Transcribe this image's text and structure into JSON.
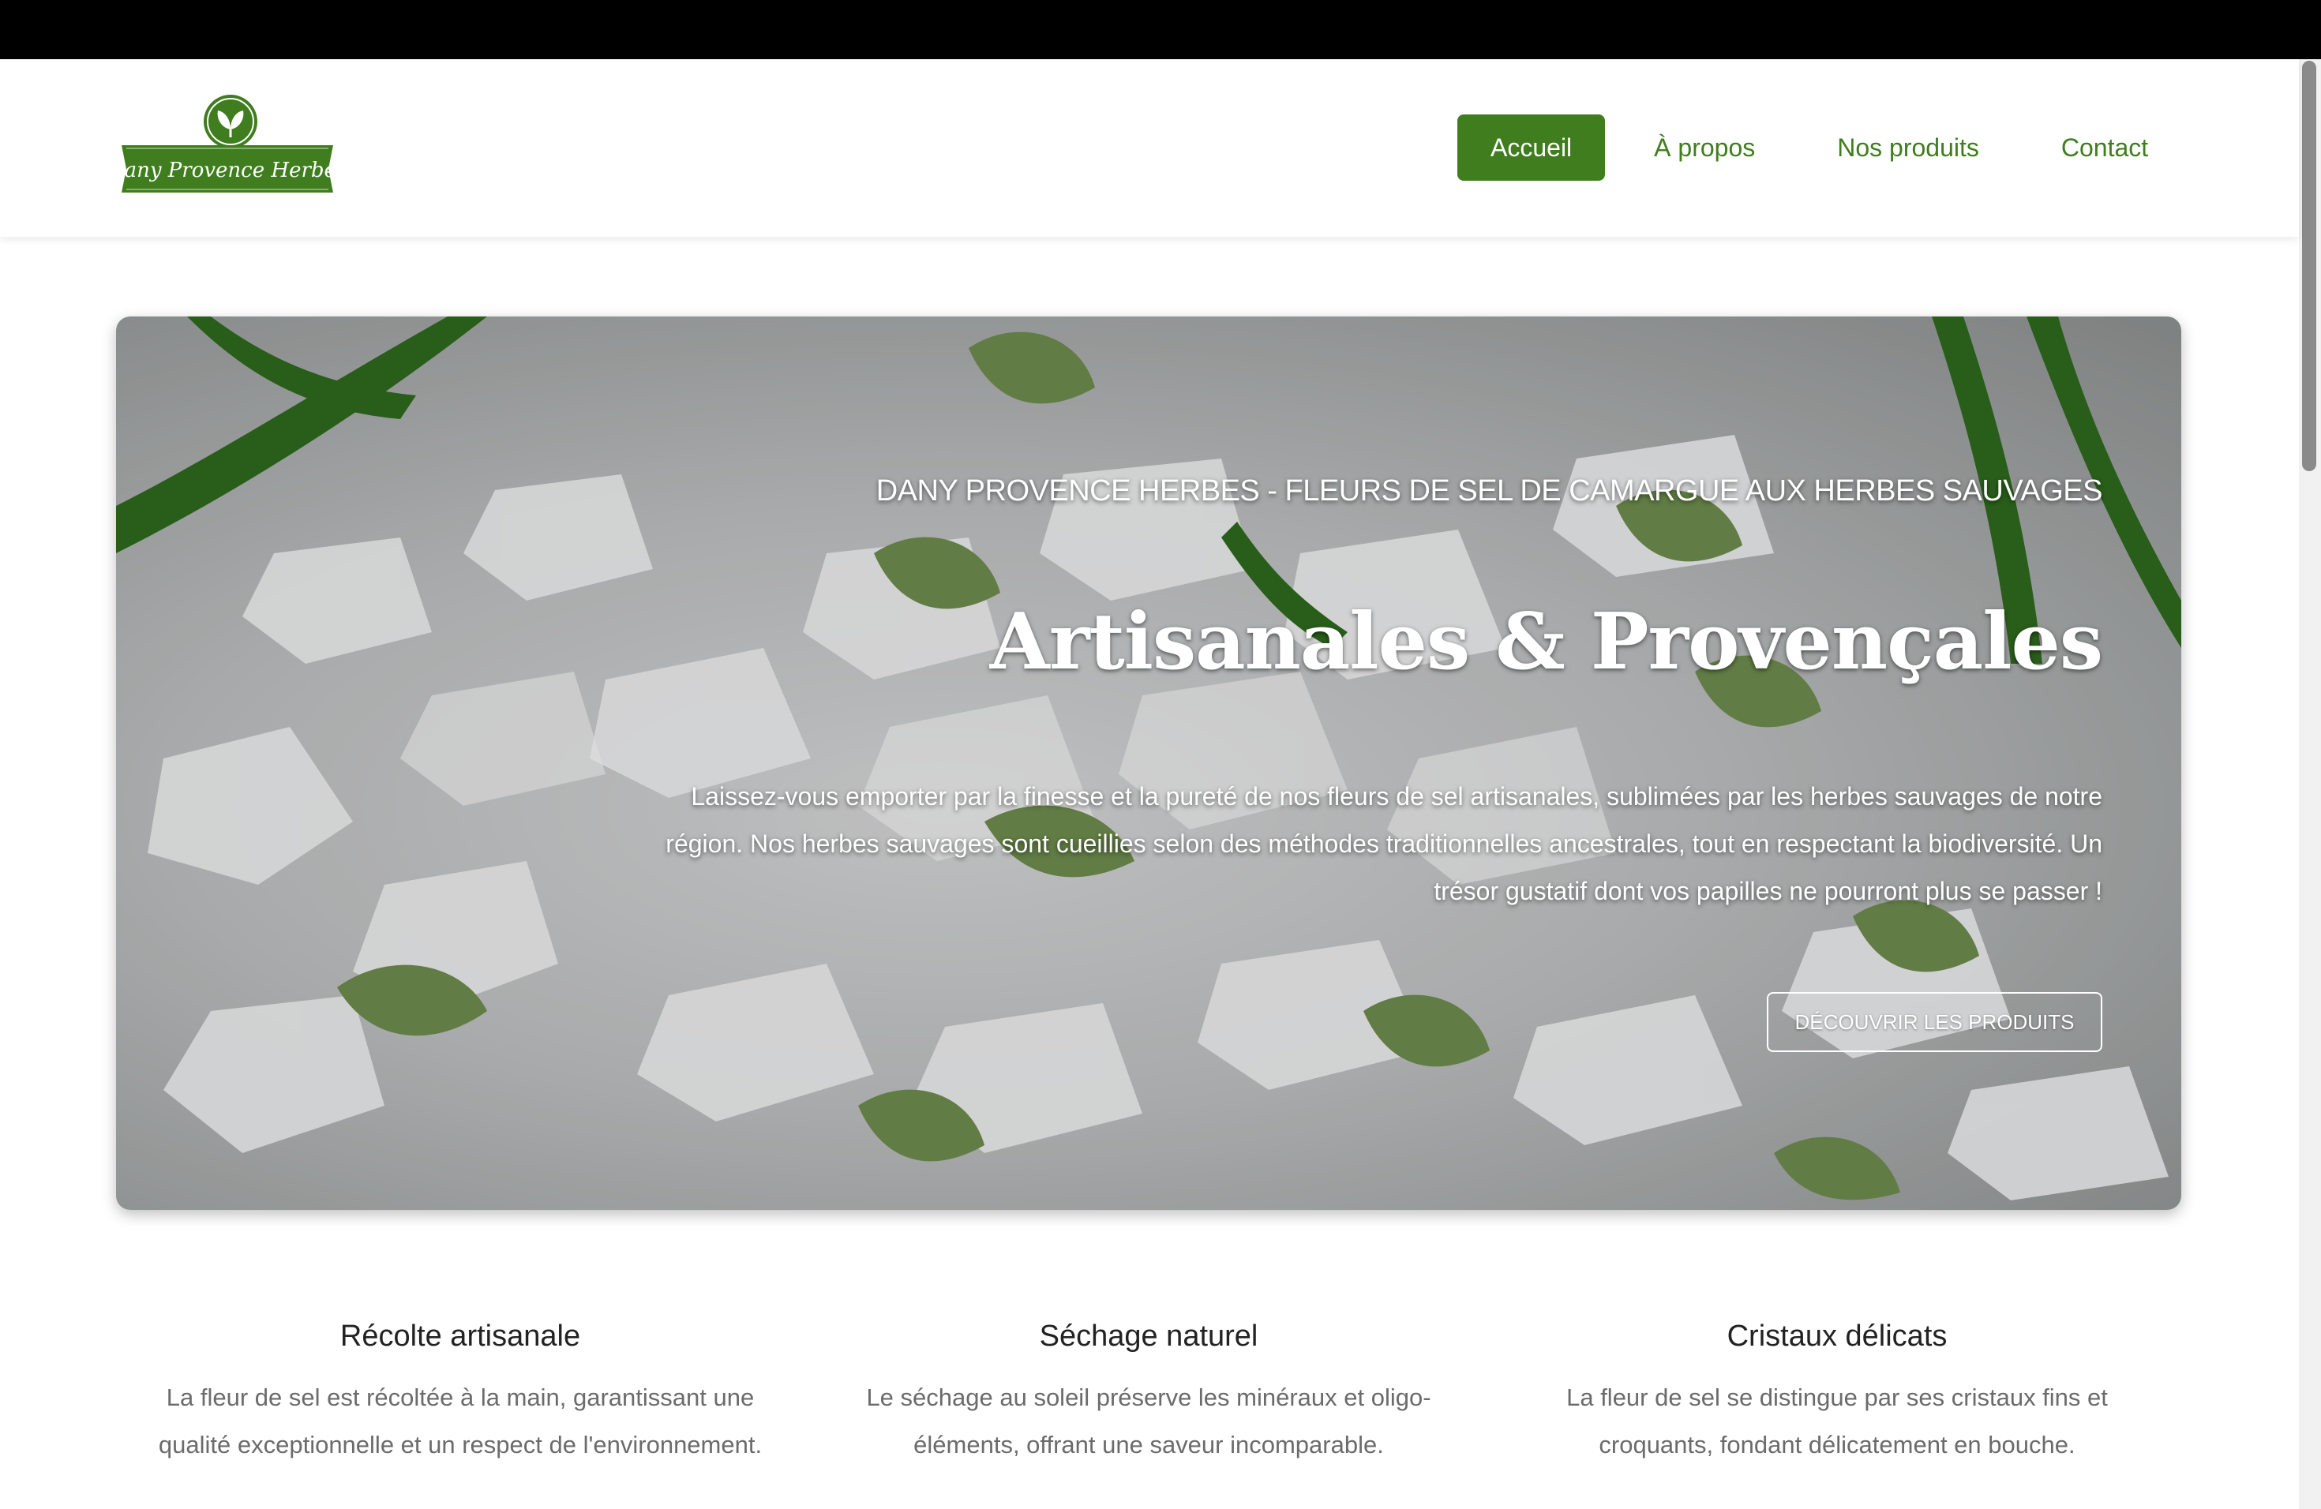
{
  "brand": {
    "logo_text": "Dany Provence Herbes"
  },
  "nav": {
    "items": [
      {
        "label": "Accueil",
        "active": true
      },
      {
        "label": "À propos"
      },
      {
        "label": "Nos produits"
      },
      {
        "label": "Contact"
      }
    ]
  },
  "hero": {
    "kicker": "DANY PROVENCE HERBES - FLEURS DE SEL DE CAMARGUE AUX HERBES SAUVAGES",
    "title": "Artisanales & Provençales",
    "text": "Laissez-vous emporter par la finesse et la pureté de nos fleurs de sel artisanales, sublimées par les herbes sauvages de notre région. Nos herbes sauvages sont cueillies selon des méthodes traditionnelles ancestrales, tout en respectant la biodiversité. Un trésor gustatif dont vos papilles ne pourront plus se passer !",
    "cta": "DÉCOUVRIR LES PRODUITS"
  },
  "features": [
    {
      "title": "Récolte artisanale",
      "text": "La fleur de sel est récoltée à la main, garantissant une qualité exceptionnelle et un respect de l'environnement."
    },
    {
      "title": "Séchage naturel",
      "text": "Le séchage au soleil préserve les minéraux et oligo-éléments, offrant une saveur incomparable."
    },
    {
      "title": "Cristaux délicats",
      "text": "La fleur de sel se distingue par ses cristaux fins et croquants, fondant délicatement en bouche."
    }
  ],
  "colors": {
    "brand_green": "#3f7d1e",
    "topbar": "#000000"
  }
}
